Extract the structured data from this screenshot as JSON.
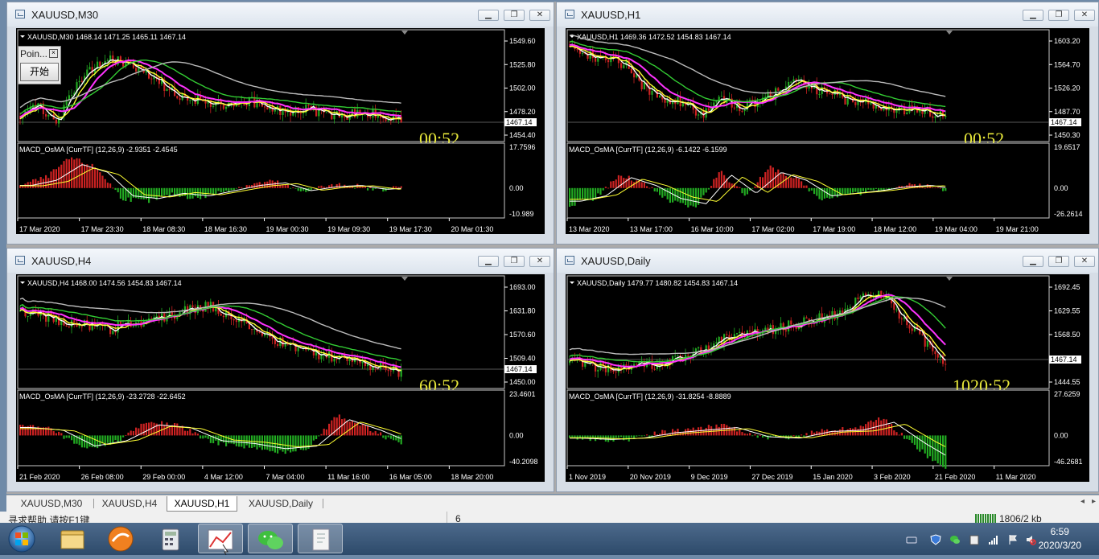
{
  "colors": {
    "bull": "#22aa22",
    "bear": "#cc2222",
    "ma1": "#ffffff",
    "ma2": "#ffff33",
    "ma3": "#ff33ff",
    "ma4": "#33cc33",
    "ma5": "#bbbbbb",
    "timer": "#e8e83a",
    "axis": "#ffffff"
  },
  "windows": [
    {
      "title": "XAUUSD,M30",
      "header": "XAUUSD,M30  1468.14 1471.25 1465.11 1467.14",
      "prices": [
        "1549.60",
        "1525.80",
        "1502.00",
        "1478.20",
        "1454.40"
      ],
      "price_tag": "1467.14",
      "timer": "00:52",
      "macd_header": "MACD_OsMA [CurrTF] (12,26,9) -2.9351 -2.4545",
      "macd_scale": [
        "17.7596",
        "0.00",
        "-10.989"
      ],
      "dates": [
        "17 Mar 2020",
        "17 Mar 23:30",
        "18 Mar 08:30",
        "18 Mar 16:30",
        "19 Mar 00:30",
        "19 Mar 09:30",
        "19 Mar 17:30",
        "20 Mar 01:30"
      ],
      "overlay": {
        "title": "Poin...",
        "button": "开始"
      }
    },
    {
      "title": "XAUUSD,H1",
      "header": "XAUUSD,H1  1469.36 1472.52 1454.83 1467.14",
      "prices": [
        "1603.20",
        "1564.70",
        "1526.20",
        "1487.70",
        "1450.30"
      ],
      "price_tag": "1467.14",
      "timer": "00:52",
      "macd_header": "MACD_OsMA [CurrTF] (12,26,9) -6.1422 -6.1599",
      "macd_scale": [
        "19.6517",
        "0.00",
        "-26.2614"
      ],
      "dates": [
        "13 Mar 2020",
        "13 Mar 17:00",
        "16 Mar 10:00",
        "17 Mar 02:00",
        "17 Mar 19:00",
        "18 Mar 12:00",
        "19 Mar 04:00",
        "19 Mar 21:00"
      ]
    },
    {
      "title": "XAUUSD,H4",
      "header": "XAUUSD,H4  1468.00 1474.56 1454.83 1467.14",
      "prices": [
        "1693.00",
        "1631.80",
        "1570.60",
        "1509.40",
        "1450.00"
      ],
      "price_tag": "1467.14",
      "timer": "60:52",
      "macd_header": "MACD_OsMA [CurrTF] (12,26,9) -23.2728 -22.6452",
      "macd_scale": [
        "23.4601",
        "0.00",
        "-40.2098"
      ],
      "dates": [
        "21 Feb 2020",
        "26 Feb 08:00",
        "29 Feb 00:00",
        "4 Mar 12:00",
        "7 Mar 04:00",
        "11 Mar 16:00",
        "16 Mar 05:00",
        "18 Mar 20:00"
      ]
    },
    {
      "title": "XAUUSD,Daily",
      "header": "XAUUSD,Daily  1479.77 1480.82 1454.83 1467.14",
      "prices": [
        "1692.45",
        "1629.55",
        "1568.50",
        "1505.60",
        "1444.55"
      ],
      "price_tag": "1467.14",
      "timer": "1020:52",
      "macd_header": "MACD_OsMA [CurrTF] (12,26,9) -31.8254 -8.8889",
      "macd_scale": [
        "27.6259",
        "0.00",
        "-46.2681"
      ],
      "dates": [
        "1 Nov 2019",
        "20 Nov 2019",
        "9 Dec 2019",
        "27 Dec 2019",
        "15 Jan 2020",
        "3 Feb 2020",
        "21 Feb 2020",
        "11 Mar 2020"
      ]
    }
  ],
  "tabs": [
    "XAUUSD,M30",
    "XAUUSD,H4",
    "XAUUSD,H1",
    "XAUUSD,Daily"
  ],
  "active_tab": "XAUUSD,H1",
  "status": {
    "help": "寻求帮助,请按F1键",
    "field": "6",
    "traffic": "1806/2 kb"
  },
  "taskbar": {
    "apps": [
      "start-orb-icon",
      "file-explorer-icon",
      "trading-app-icon",
      "calculator-icon",
      "chart-app-icon",
      "wechat-icon",
      "document-app-icon"
    ],
    "time": "6:59",
    "date": "2020/3/20"
  }
}
